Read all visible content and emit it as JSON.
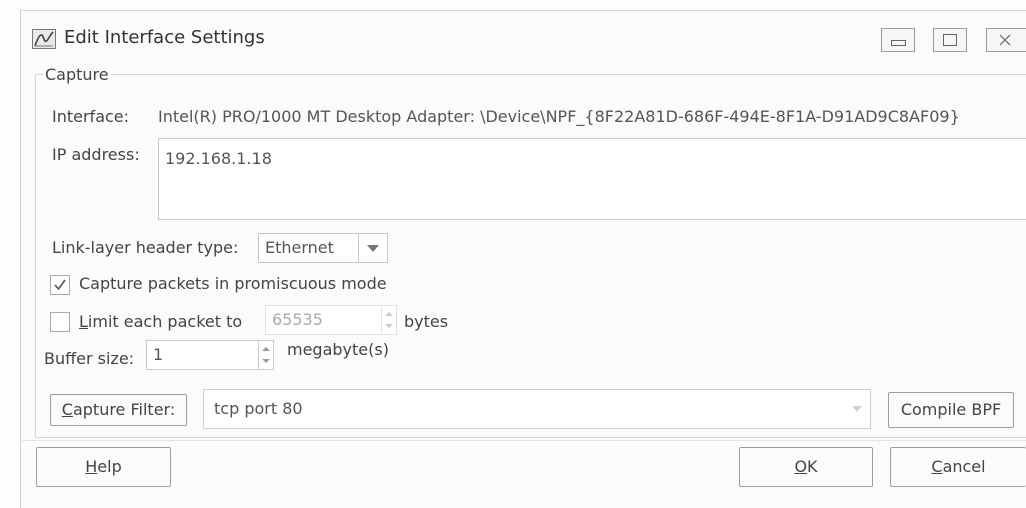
{
  "window": {
    "title": "Edit Interface Settings",
    "controls": {
      "minimize_icon": "minimize-icon",
      "maximize_icon": "maximize-icon",
      "close_icon": "close-icon"
    }
  },
  "capture": {
    "group_label": "Capture",
    "interface_label": "Interface:",
    "interface_value": "Intel(R) PRO/1000 MT Desktop Adapter: \\Device\\NPF_{8F22A81D-686F-494E-8F1A-D91AD9C8AF09}",
    "ip_label": "IP address:",
    "ip_value": "192.168.1.18",
    "link_layer_label": "Link-layer header type:",
    "link_layer_value": "Ethernet",
    "promiscuous_label": "Capture packets in promiscuous mode",
    "promiscuous_checked": true,
    "limit_label_prefix": "L",
    "limit_label_rest": "imit each packet to",
    "limit_checked": false,
    "limit_value": "65535",
    "limit_unit": "bytes",
    "buffer_label": "Buffer size:",
    "buffer_value": "1",
    "buffer_unit": "megabyte(s)"
  },
  "filter": {
    "button_prefix": "C",
    "button_rest": "apture Filter:",
    "value": "tcp port 80",
    "compile_label": "Compile BPF"
  },
  "footer": {
    "help_prefix": "H",
    "help_rest": "elp",
    "ok_prefix": "O",
    "ok_rest": "K",
    "cancel_prefix": "C",
    "cancel_rest": "ancel"
  }
}
